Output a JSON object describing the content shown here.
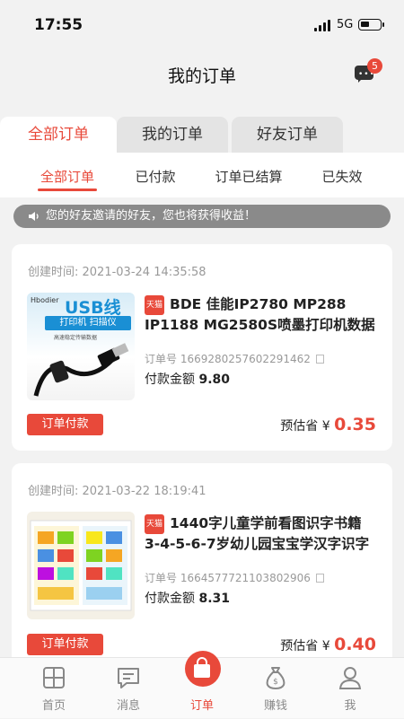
{
  "status": {
    "time": "17:55",
    "network": "5G"
  },
  "header": {
    "title": "我的订单",
    "message_count": "5"
  },
  "tabs": [
    {
      "label": "全部订单",
      "active": true
    },
    {
      "label": "我的订单",
      "active": false
    },
    {
      "label": "好友订单",
      "active": false
    }
  ],
  "subtabs": [
    {
      "label": "全部订单",
      "active": true
    },
    {
      "label": "已付款",
      "active": false
    },
    {
      "label": "订单已结算",
      "active": false
    },
    {
      "label": "已失效",
      "active": false
    }
  ],
  "notice": "您的好友邀请的好友，您也将获得收益！",
  "orders": [
    {
      "created": "创建时间:  2021-03-24 14:35:58",
      "platform": "天猫",
      "title": "BDE 佳能IP2780 MP288",
      "title2": "IP1188 MG2580S喷墨打印机数据",
      "order_no": "订单号  1669280257602291462",
      "paid_label": "付款金额",
      "paid_amount": "9.80",
      "pay_button": "订单付款",
      "save_label": "预估省 ¥",
      "save_amount": "0.35",
      "thumb": {
        "brand": "Hbodier",
        "headline": "USB线",
        "sub": "打印机 扫描仪",
        "tag": "高速稳定传输数据"
      }
    },
    {
      "created": "创建时间:  2021-03-22 18:19:41",
      "platform": "天猫",
      "title": "1440字儿童学前看图识字书籍",
      "title2": "3-4-5-6-7岁幼儿园宝宝学汉字识字",
      "order_no": "订单号  1664577721103802906",
      "paid_label": "付款金额",
      "paid_amount": "8.31",
      "pay_button": "订单付款",
      "save_label": "预估省 ¥",
      "save_amount": "0.40"
    }
  ],
  "bottom_nav": [
    {
      "label": "首页",
      "icon": "home-grid-icon"
    },
    {
      "label": "消息",
      "icon": "message-icon"
    },
    {
      "label": "订单",
      "icon": "bag-icon"
    },
    {
      "label": "赚钱",
      "icon": "money-bag-icon"
    },
    {
      "label": "我",
      "icon": "user-icon"
    }
  ],
  "colors": {
    "accent": "#e8493a",
    "background": "#f2f2f2"
  }
}
